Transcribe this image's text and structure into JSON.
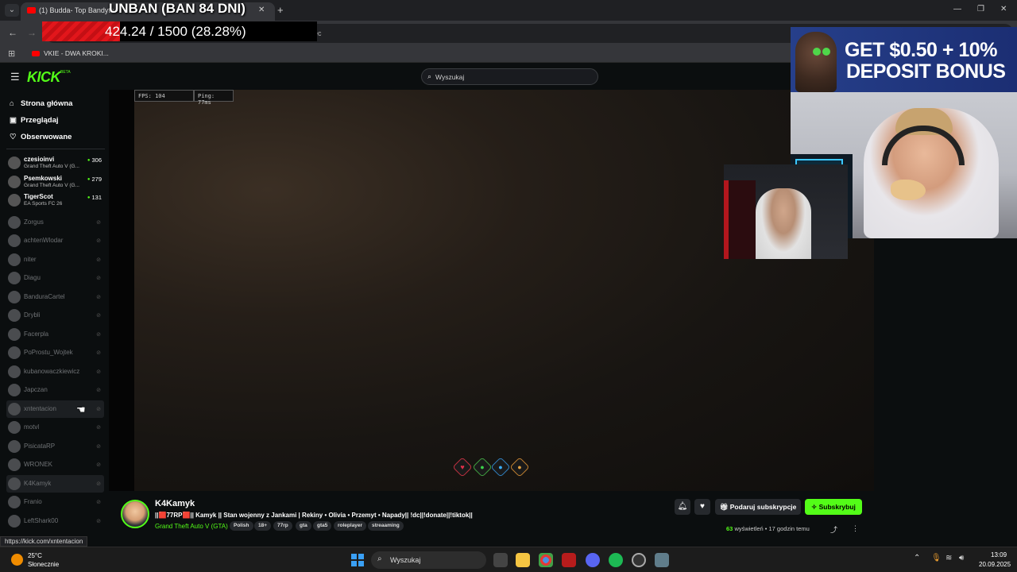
{
  "browser": {
    "tab_title": "(1) Budda- Top Bandyta -",
    "bookmark_label": "VKIE - DWA KROKI...",
    "url_fragment": "ec"
  },
  "overlay": {
    "ban_text": "UNBAN (BAN 84 DNI)",
    "progress_text": "424.24 / 1500 (28.28%)",
    "progress_fraction": 0.2828,
    "bar_color": "#e2161b"
  },
  "kick": {
    "logo": "KICK",
    "logo_sup": "BETA",
    "search_placeholder": "Wyszukaj",
    "brand_color": "#53fc18"
  },
  "sidebar": {
    "nav": [
      {
        "label": "Strona główna",
        "icon": "home-icon"
      },
      {
        "label": "Przeglądaj",
        "icon": "browse-icon"
      },
      {
        "label": "Obserwowane",
        "icon": "heart-icon"
      }
    ],
    "live": [
      {
        "name": "czesioinvi",
        "game": "Grand Theft Auto V (G...",
        "viewers": "306"
      },
      {
        "name": "Psemkowski",
        "game": "Grand Theft Auto V (G...",
        "viewers": "279"
      },
      {
        "name": "TigerScot",
        "game": "EA Sports FC 26",
        "viewers": "131"
      }
    ],
    "offline": [
      "Zorgus",
      "achtenWlodar",
      "niter",
      "Diagu",
      "BanduraCartel",
      "Drybli",
      "Facerpla",
      "PoProstu_Wojtek",
      "kubanowaczkiewicz",
      "Japczan",
      "xntentacion",
      "motvl",
      "PisicataRP",
      "WRONEK",
      "K4Kamyk",
      "Franio",
      "LeftShark00"
    ]
  },
  "video": {
    "fps": "FPS: 104",
    "ping": "Ping: 77ms"
  },
  "ad": {
    "line1": "GET $0.50 + 10%",
    "line2": "DEPOSIT BONUS"
  },
  "stream": {
    "username": "K4Kamyk",
    "title": "||🟥77RP🟥|| Kamyk || Stan wojenny z Jankami | Rekiny • Olivia • Przemyt • Napady|| !dc||!donate||!tiktok||",
    "game": "Grand Theft Auto V (GTA)",
    "tags": [
      "Polish",
      "18+",
      "77rp",
      "gta",
      "gta5",
      "roleplayer",
      "streaaming"
    ],
    "gift_label": "Podaruj subskrypcje",
    "subscribe_label": "Subskrybuj",
    "views_count": "63",
    "views_label": "wyświetleń",
    "time_ago": "17 godzin temu"
  },
  "status_url": "https://kick.com/xntentacion",
  "taskbar": {
    "temp": "25°C",
    "condition": "Słonecznie",
    "search": "Wyszukaj",
    "time": "13:09",
    "date": "20.09.2025"
  }
}
